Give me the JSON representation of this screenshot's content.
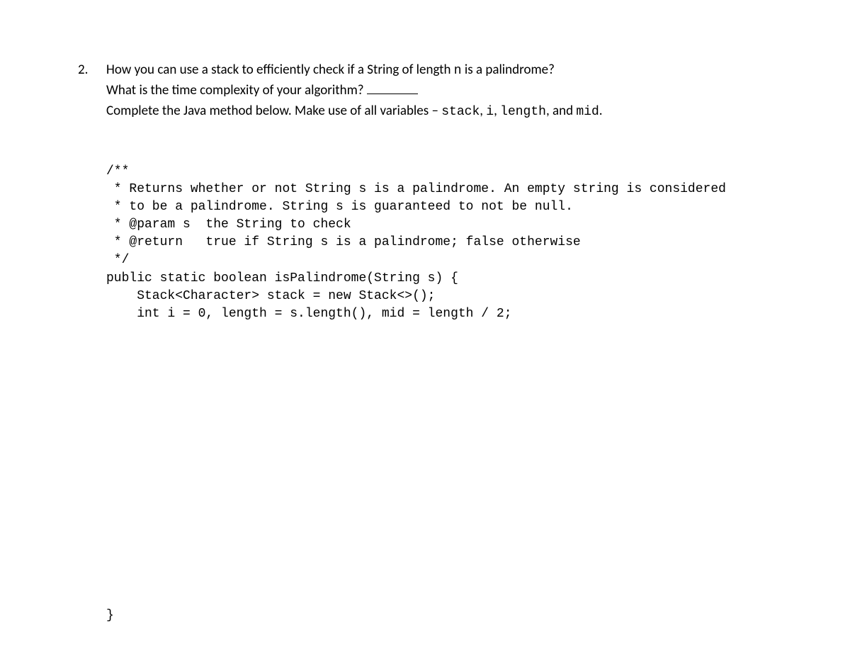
{
  "question": {
    "number": "2.",
    "line1_prefix": "How you can use a stack to efficiently check if a String of length ",
    "line1_code": "n",
    "line1_suffix": " is a palindrome?",
    "line2_prefix": "What is the time complexity of your algorithm? ",
    "line3_prefix": "Complete the Java method below. Make use of all variables – ",
    "line3_code1": "stack",
    "line3_sep1": ", ",
    "line3_code2": "i",
    "line3_sep2": ", ",
    "line3_code3": "length",
    "line3_sep3": ", and ",
    "line3_code4": "mid",
    "line3_suffix": "."
  },
  "code": {
    "l1": "/**",
    "l2": " * Returns whether or not String s is a palindrome. An empty string is considered",
    "l3": " * to be a palindrome. String s is guaranteed to not be null.",
    "l4": " * @param s  the String to check",
    "l5": " * @return   true if String s is a palindrome; false otherwise",
    "l6": " */",
    "l7": "public static boolean isPalindrome(String s) {",
    "l8": "    Stack<Character> stack = new Stack<>();",
    "l9": "    int i = 0, length = s.length(), mid = length / 2;",
    "close": "}"
  }
}
